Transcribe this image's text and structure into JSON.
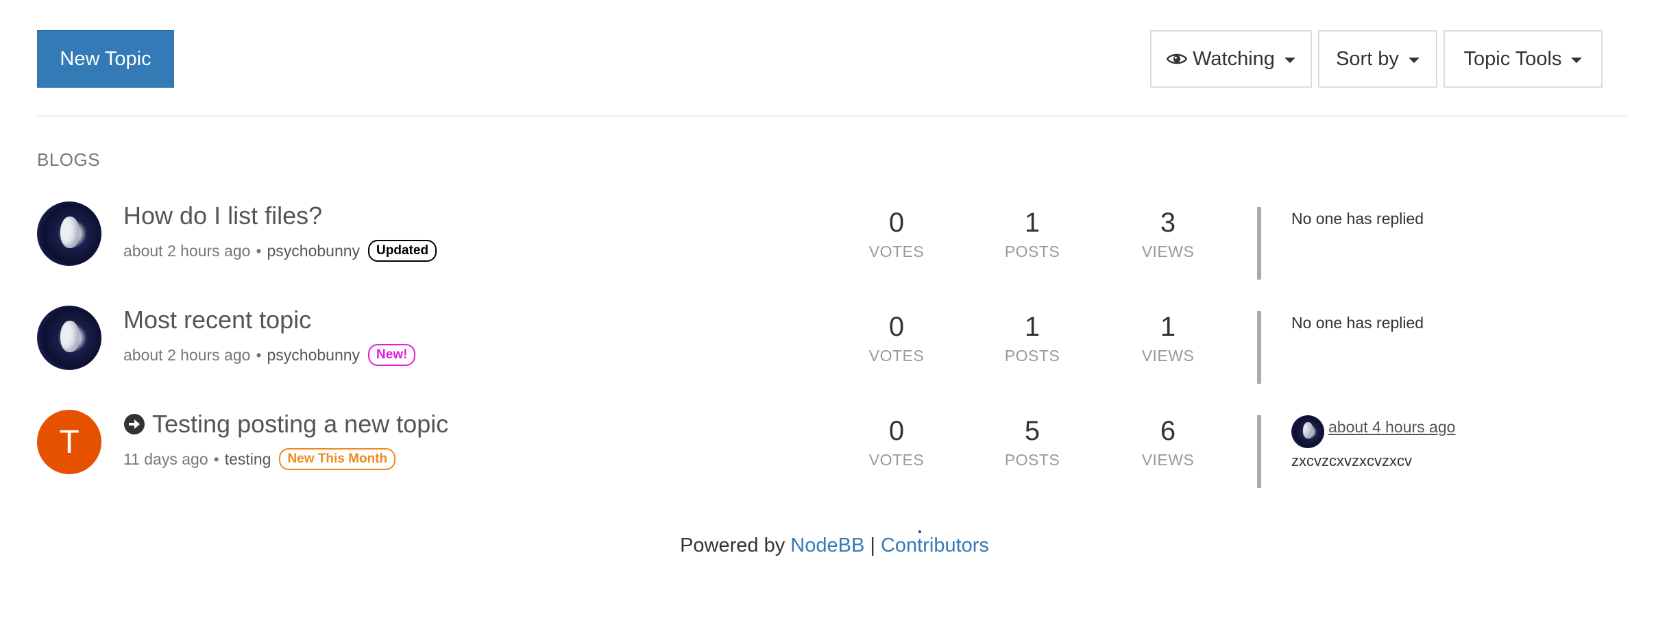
{
  "toolbar": {
    "new_topic_label": "New Topic",
    "watching_label": "Watching",
    "sort_label": "Sort by",
    "tools_label": "Topic Tools"
  },
  "category": {
    "label": "BLOGS"
  },
  "topics": [
    {
      "title": "How do I list files?",
      "time": "about 2 hours ago",
      "separator": "•",
      "author": "psychobunny",
      "badge": "Updated",
      "votes": "0",
      "votes_label": "VOTES",
      "posts": "1",
      "posts_label": "POSTS",
      "views": "3",
      "views_label": "VIEWS",
      "teaser": "No one has replied"
    },
    {
      "title": "Most recent topic",
      "time": "about 2 hours ago",
      "separator": "•",
      "author": "psychobunny",
      "badge": "New!",
      "votes": "0",
      "votes_label": "VOTES",
      "posts": "1",
      "posts_label": "POSTS",
      "views": "1",
      "views_label": "VIEWS",
      "teaser": "No one has replied"
    },
    {
      "title": "Testing posting a new topic",
      "avatar_letter": "T",
      "time": "11 days ago",
      "separator": "•",
      "author": "testing",
      "badge": "New This Month",
      "votes": "0",
      "votes_label": "VOTES",
      "posts": "5",
      "posts_label": "POSTS",
      "views": "6",
      "views_label": "VIEWS",
      "teaser_time": "about 4 hours ago",
      "teaser_content": "zxcvzcxvzxcvzxcv"
    }
  ],
  "footer": {
    "powered_by": "Powered by",
    "nodebb_link": "NodeBB",
    "divider": "|",
    "contributors_link": "Contributors"
  },
  "colors": {
    "primary": "#337ab7",
    "letter_avatar": "#e65100",
    "badge_new": "#e020e0",
    "badge_month": "#f08a1c"
  },
  "icons": {
    "watching": "eye-icon",
    "caret": "caret-down-icon",
    "moved": "arrow-circle-right-icon"
  }
}
